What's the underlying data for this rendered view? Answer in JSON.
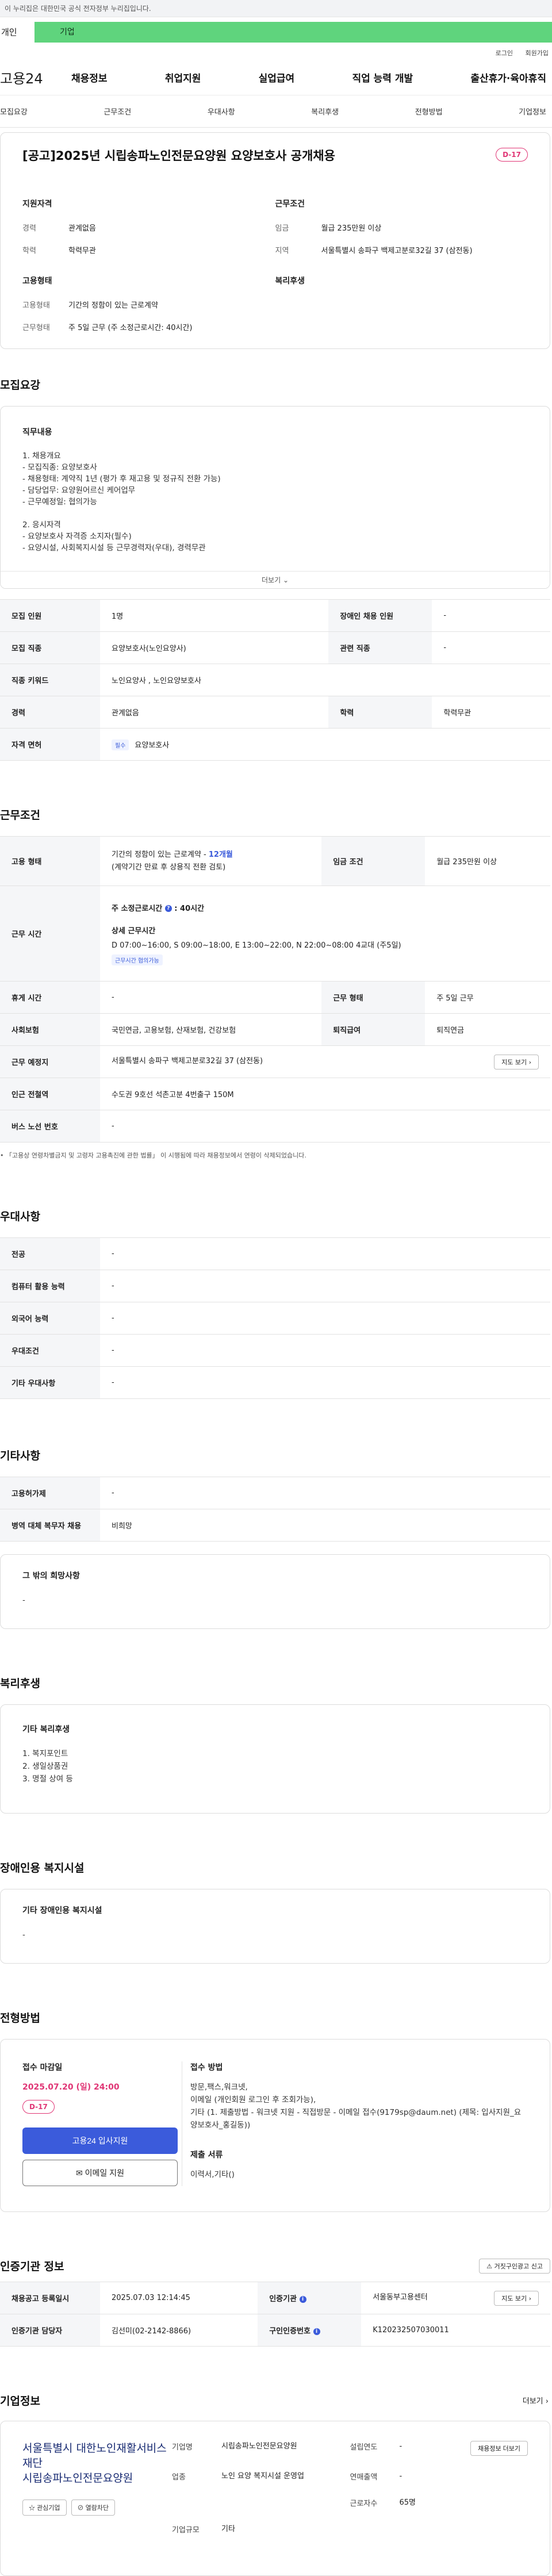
{
  "gov_banner": "이 누리집은 대한민국 공식 전자정부 누리집입니다.",
  "tabs": {
    "personal": "개인",
    "business": "기업"
  },
  "util": {
    "login": "로그인",
    "join": "회원가입"
  },
  "logo": "고용24",
  "gnb": [
    "채용정보",
    "취업지원",
    "실업급여",
    "직업 능력 개발",
    "출산휴가·육아휴직"
  ],
  "subnav": [
    "모집요강",
    "근무조건",
    "우대사항",
    "복리후생",
    "전형방법",
    "기업정보"
  ],
  "job": {
    "title": "[공고]2025년 시립송파노인전문요양원 요양보호사 공개채용",
    "dday": "D-17",
    "qual_title": "지원자격",
    "work_title": "근무조건",
    "emp_title": "고용형태",
    "welfare_title": "복리후생",
    "qual": [
      {
        "k": "경력",
        "v": "관계없음"
      },
      {
        "k": "학력",
        "v": "학력무관"
      }
    ],
    "work": [
      {
        "k": "임금",
        "v": "월급 235만원 이상"
      },
      {
        "k": "지역",
        "v": "서울특별시 송파구 백제고분로32길 37 (삼전동)"
      }
    ],
    "emp": [
      {
        "k": "고용형태",
        "v": "기간의 정함이 있는 근로계약"
      },
      {
        "k": "근무형태",
        "v": "주 5일 근무 (주 소정근로시간: 40시간)"
      }
    ]
  },
  "recruit": {
    "section": "모집요강",
    "desc_title": "직무내용",
    "lines": [
      "1. 채용개요",
      "- 모집직종: 요양보호사",
      "- 채용형태: 계약직 1년 (평가 후 재고용 및 정규직 전환 가능)",
      "- 담당업무: 요양원어르신 케어업무",
      "- 근무예정일: 협의가능",
      "",
      "2. 응시자격",
      "- 요양보호사 자격증 소지자(필수)",
      "- 요양시설, 사회복지시설 등 근무경력자(우대), 경력무관"
    ],
    "more": "더보기",
    "table": [
      {
        "k1": "모집 인원",
        "v1": "1명",
        "k2": "장애인 채용 인원",
        "v2": "-"
      },
      {
        "k1": "모집 직종",
        "v1": "요양보호사(노인요양사)",
        "k2": "관련 직종",
        "v2": "-"
      },
      {
        "k1": "직종 키워드",
        "v1": "노인요양사 , 노인요양보호사"
      },
      {
        "k1": "경력",
        "v1": "관계없음",
        "k2": "학력",
        "v2": "학력무관"
      },
      {
        "k1": "자격 면허",
        "tag": "필수",
        "v1": "요양보호사"
      }
    ]
  },
  "conditions": {
    "section": "근무조건",
    "emp_k": "고용 형태",
    "emp_v1": "기간의 정함이 있는 근로계약 - ",
    "emp_months": "12개월",
    "emp_v2": "(계약기간 만료 후 상용직 전환 검토)",
    "wage_k": "임금 조건",
    "wage_v": "월급 235만원 이상",
    "hours_k": "근무 시간",
    "hours_total": "주 소정근로시간 ",
    "hours_n": "40시간",
    "hours_detail_title": "상세 근무시간",
    "hours_detail": "D 07:00~16:00, S 09:00~18:00, E 13:00~22:00, N 22:00~08:00  4교대 (주5일)",
    "hours_tag": "근무시간 협의가능",
    "break_k": "휴게 시간",
    "break_v": "-",
    "form_k": "근무 형태",
    "form_v": "주 5일 근무",
    "ins_k": "사회보험",
    "ins_v": "국민연금, 고용보험, 산재보험, 건강보험",
    "retire_k": "퇴직급여",
    "retire_v": "퇴직연금",
    "place_k": "근무 예정지",
    "place_v": "서울특별시 송파구 백제고분로32길 37 (삼전동)",
    "map_btn": "지도 보기",
    "subway_k": "인근 전철역",
    "subway_v": "수도권 9호선 석촌고분 4번출구 150M",
    "bus_k": "버스 노선 번호",
    "bus_v": "-",
    "note": "「고용상 연령차별금지 및 고령자 고용촉진에 관한 법률」 이 시행됨에 따라 채용정보에서 연령이 삭제되었습니다."
  },
  "preference": {
    "section": "우대사항",
    "rows": [
      {
        "k": "전공",
        "v": "-"
      },
      {
        "k": "컴퓨터 활용 능력",
        "v": "-"
      },
      {
        "k": "외국어 능력",
        "v": "-"
      },
      {
        "k": "우대조건",
        "v": "-"
      },
      {
        "k": "기타 우대사항",
        "v": "-"
      }
    ]
  },
  "etc": {
    "section": "기타사항",
    "rows": [
      {
        "k": "고용허가제",
        "v": "-"
      },
      {
        "k": "병역 대체 복무자 채용",
        "v": "비희망"
      }
    ],
    "wish_title": "그 밖의 희망사항",
    "wish_v": "-"
  },
  "welfare": {
    "section": "복리후생",
    "title": "기타 복리후생",
    "lines": [
      "1. 복지포인트",
      "2. 생일상품권",
      "3. 명절 상여 등"
    ]
  },
  "disabled": {
    "section": "장애인용 복지시설",
    "title": "기타 장애인용 복지시설",
    "v": "-"
  },
  "apply": {
    "section": "전형방법",
    "deadline_title": "접수 마감일",
    "deadline": "2025.07.20 (일) 24:00",
    "dday": "D-17",
    "apply_btn": "고용24 입사지원",
    "email_btn": "이메일 지원",
    "method_title": "접수 방법",
    "method_lines": [
      "방문,팩스,워크넷,",
      "이메일 (개인회원 로그인 후 조회가능),",
      "기타 (1. 제출방법    - 워크넷 지원    - 직접방문    - 이메일 접수(9179sp@daum.net)       (제목: 입사지원_요양보호사_홍길동))"
    ],
    "docs_title": "제출 서류",
    "docs": "이력서,기타()"
  },
  "agency": {
    "section": "인증기관 정보",
    "report_btn": "거짓구인광고 신고",
    "reg_k": "채용공고 등록일시",
    "reg_v": "2025.07.03 12:14:45",
    "org_k": "인증기관",
    "org_v": "서울동부고용센터",
    "map_btn": "지도 보기",
    "mgr_k": "인증기관 담당자",
    "mgr_v": "김선미(02-2142-8866)",
    "no_k": "구인인증번호",
    "no_v": "K120232507030011"
  },
  "company": {
    "section": "기업정보",
    "more": "더보기",
    "logo_line1": "서울특별시 대한노인재활서비스재단",
    "logo_line2": "시립송파노인전문요양원",
    "fav_btn": "관심기업",
    "block_btn": "열람차단",
    "info": [
      {
        "k": "기업명",
        "v": "시립송파노인전문요양원"
      },
      {
        "k": "설립연도",
        "v": "-"
      },
      {
        "k": "업종",
        "v": "노인 요양 복지시설 운영업"
      },
      {
        "k": "연매출액",
        "v": "-"
      },
      {
        "k": "",
        "v": ""
      },
      {
        "k": "근로자수",
        "v": "65명"
      },
      {
        "k": "기업규모",
        "v": "기타"
      }
    ],
    "recruit_btn": "채용정보 더보기"
  }
}
